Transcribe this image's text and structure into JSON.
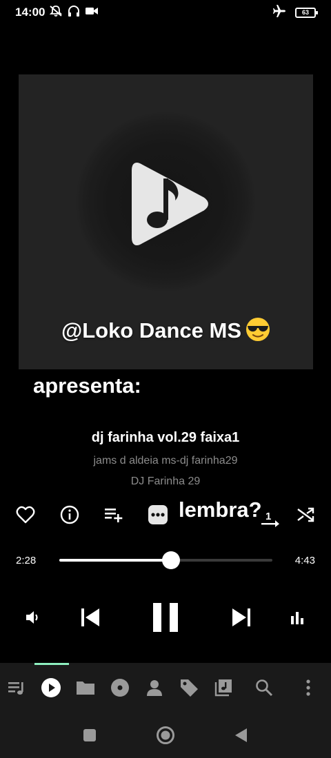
{
  "status_bar": {
    "time": "14:00",
    "battery_level": "63",
    "icons": [
      "mute-vibrate-icon",
      "headphones-icon",
      "video-camera-icon",
      "airplane-mode-icon",
      "battery-icon"
    ]
  },
  "artwork": {
    "caption": "@Loko Dance MS",
    "caption_emoji": "smiling-face-with-sunglasses",
    "logo_icon": "play-music-note-icon"
  },
  "overlays": {
    "top": "apresenta:",
    "right": "lembra?"
  },
  "track": {
    "title": "dj farinha vol.29 faixa1",
    "artist": "jams d aldeia ms-dj farinha29",
    "album": "DJ Farinha 29"
  },
  "actions": [
    "favorite-icon",
    "info-icon",
    "add-to-playlist-icon",
    "more-icon",
    "repeat-one-icon",
    "shuffle-icon"
  ],
  "progress": {
    "current": "2:28",
    "total": "4:43",
    "fraction": 0.523
  },
  "controls": [
    "volume-icon",
    "previous-icon",
    "pause-icon",
    "next-icon",
    "equalizer-icon"
  ],
  "bottom_nav": {
    "items": [
      "queue-icon",
      "now-playing-icon",
      "folders-icon",
      "albums-icon",
      "artists-icon",
      "genres-icon",
      "library-icon",
      "search-icon",
      "menu-icon"
    ],
    "active": "now-playing-icon",
    "accent_color": "#8ef0c0"
  },
  "colors": {
    "background": "#000000",
    "artwork_bg": "#232323",
    "secondary_text": "#8c8c8c",
    "nav_bg": "#1a1a1a"
  }
}
